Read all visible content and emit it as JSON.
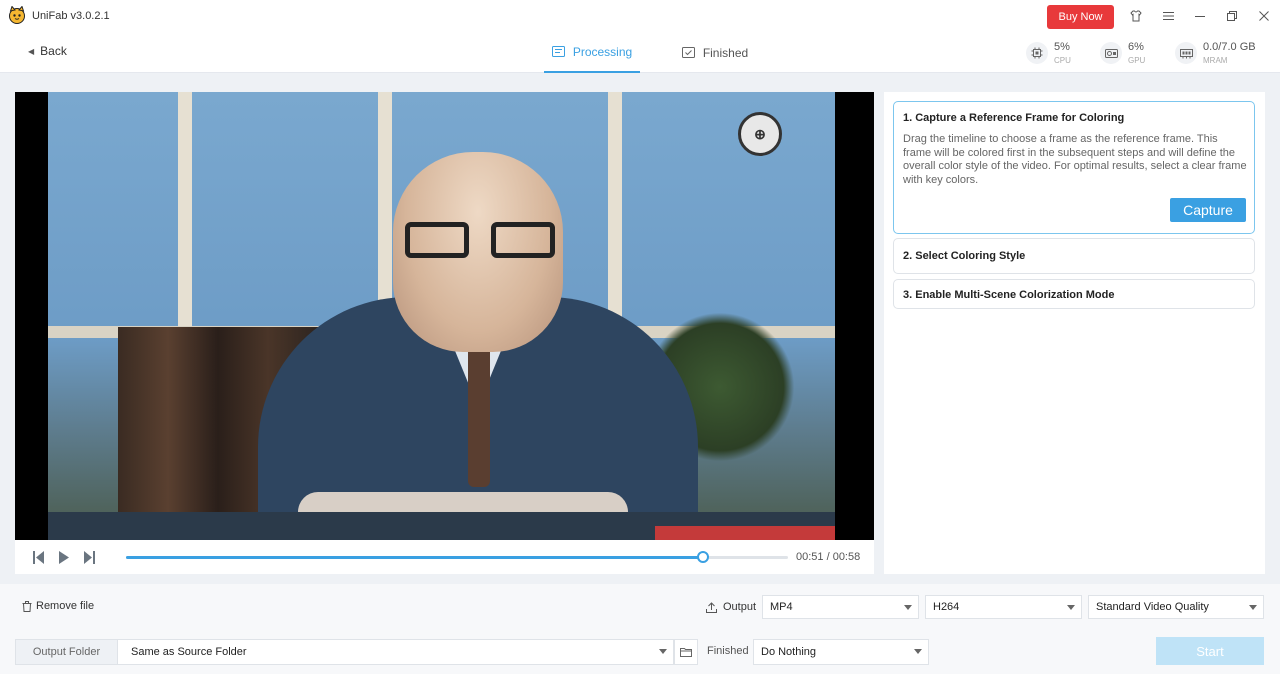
{
  "app": {
    "title": "UniFab v3.0.2.1",
    "buy_label": "Buy Now"
  },
  "icons": {
    "logo": "unifab-cat-logo-icon",
    "shirt": "skin-icon",
    "menu": "hamburger-menu-icon",
    "minimize": "minimize-icon",
    "restore": "restore-icon",
    "close": "close-icon"
  },
  "nav": {
    "back_label": "Back",
    "tabs": [
      {
        "label": "Processing",
        "active": true
      },
      {
        "label": "Finished",
        "active": false
      }
    ],
    "stats": [
      {
        "value": "5%",
        "label": "CPU",
        "icon": "cpu-icon"
      },
      {
        "value": "6%",
        "label": "GPU",
        "icon": "gpu-icon"
      },
      {
        "value": "0.0/7.0 GB",
        "label": "MRAM",
        "icon": "memory-icon"
      }
    ]
  },
  "player": {
    "current_time": "00:51",
    "total_time": "00:58",
    "time_display": "00:51 / 00:58",
    "progress": 0.872
  },
  "steps": [
    {
      "title": "1. Capture a Reference Frame for Coloring",
      "description": "Drag the timeline to choose a frame as the reference frame. This frame will be colored first in the subsequent steps and will define the overall color style of the video. For optimal results, select a clear frame with key colors.",
      "button_label": "Capture",
      "expanded": true
    },
    {
      "title": "2. Select Coloring Style",
      "expanded": false
    },
    {
      "title": "3. Enable Multi-Scene Colorization Mode",
      "expanded": false
    }
  ],
  "bottom": {
    "remove_file_label": "Remove file",
    "output_label": "Output",
    "format": "MP4",
    "codec": "H264",
    "quality": "Standard Video Quality",
    "output_folder_label": "Output Folder",
    "output_folder_value": "Same as Source Folder",
    "finished_label": "Finished",
    "finished_action": "Do Nothing",
    "start_label": "Start"
  },
  "colors": {
    "accent": "#3aa0e2",
    "buy": "#e8393b",
    "start_disabled": "#bfe3f7"
  }
}
